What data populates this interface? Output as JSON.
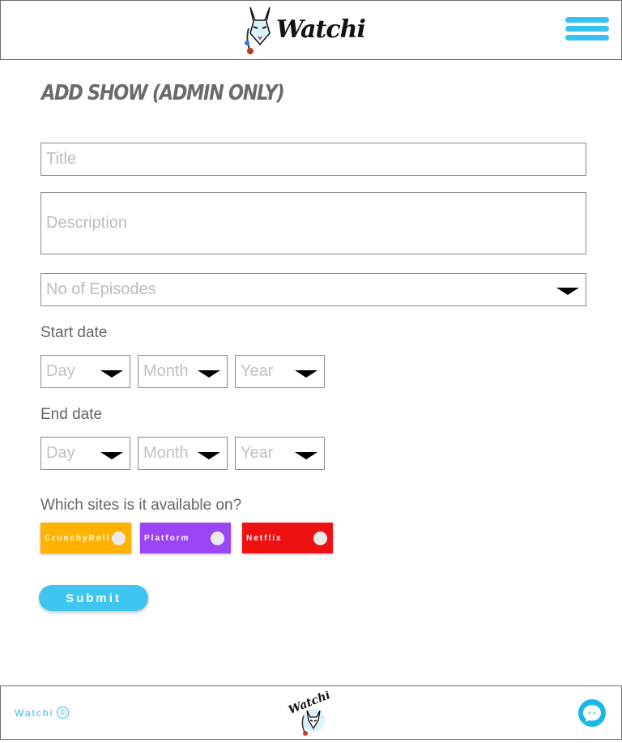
{
  "header": {
    "brand": "Watchi",
    "menu_icon": "hamburger-menu-icon"
  },
  "page": {
    "title": "Add Show (Admin Only)"
  },
  "form": {
    "title_placeholder": "Title",
    "description_placeholder": "Description",
    "episodes_placeholder": "No of Episodes",
    "start_label": "Start date",
    "end_label": "End date",
    "day": "Day",
    "month": "Month",
    "year": "Year",
    "sites_label": "Which sites is it available on?",
    "sites": [
      {
        "label": "CrunchyRoll",
        "color": "#ffb300"
      },
      {
        "label": "Platform",
        "color": "#9b46f5"
      },
      {
        "label": "Netflix",
        "color": "#ee1111"
      }
    ],
    "submit_label": "Submit"
  },
  "footer": {
    "copyright": "Watchi",
    "copyright_icon": "copyright-icon",
    "logo_text": "Watchi",
    "chat_icon": "messenger-icon"
  },
  "colors": {
    "accent": "#36c3ee",
    "border": "#8a8a8a"
  }
}
